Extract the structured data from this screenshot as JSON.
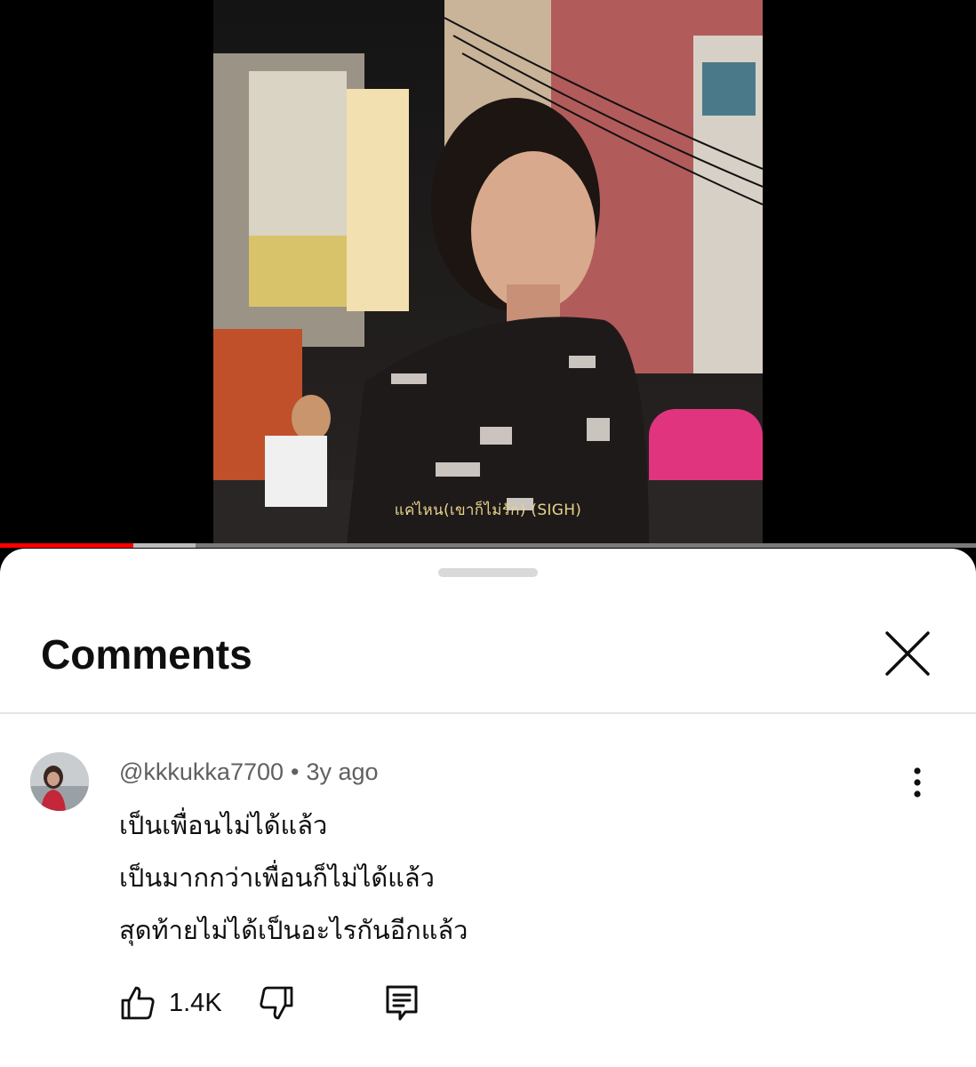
{
  "video": {
    "caption": "แค่ไหน(เขาก็ไม่รัก) (SIGH)",
    "progress_played_fraction": 0.137,
    "progress_buffered_fraction": 0.2
  },
  "comments_panel": {
    "title": "Comments",
    "close_icon": "close-icon"
  },
  "comment": {
    "author": "@kkkukka7700",
    "separator": "•",
    "time": "3y ago",
    "lines": [
      "เป็นเพื่อนไม่ได้แล้ว",
      "เป็นมากกว่าเพื่อนก็ไม่ได้แล้ว",
      "สุดท้ายไม่ได้เป็นอะไรกันอีกแล้ว"
    ],
    "like_count": "1.4K",
    "icons": [
      "thumb-up-icon",
      "thumb-down-icon",
      "reply-icon",
      "more-vert-icon"
    ]
  },
  "colors": {
    "progress": "#ff0000",
    "caption": "#e8d28a",
    "text_primary": "#0f0f0f",
    "text_secondary": "#606060"
  }
}
